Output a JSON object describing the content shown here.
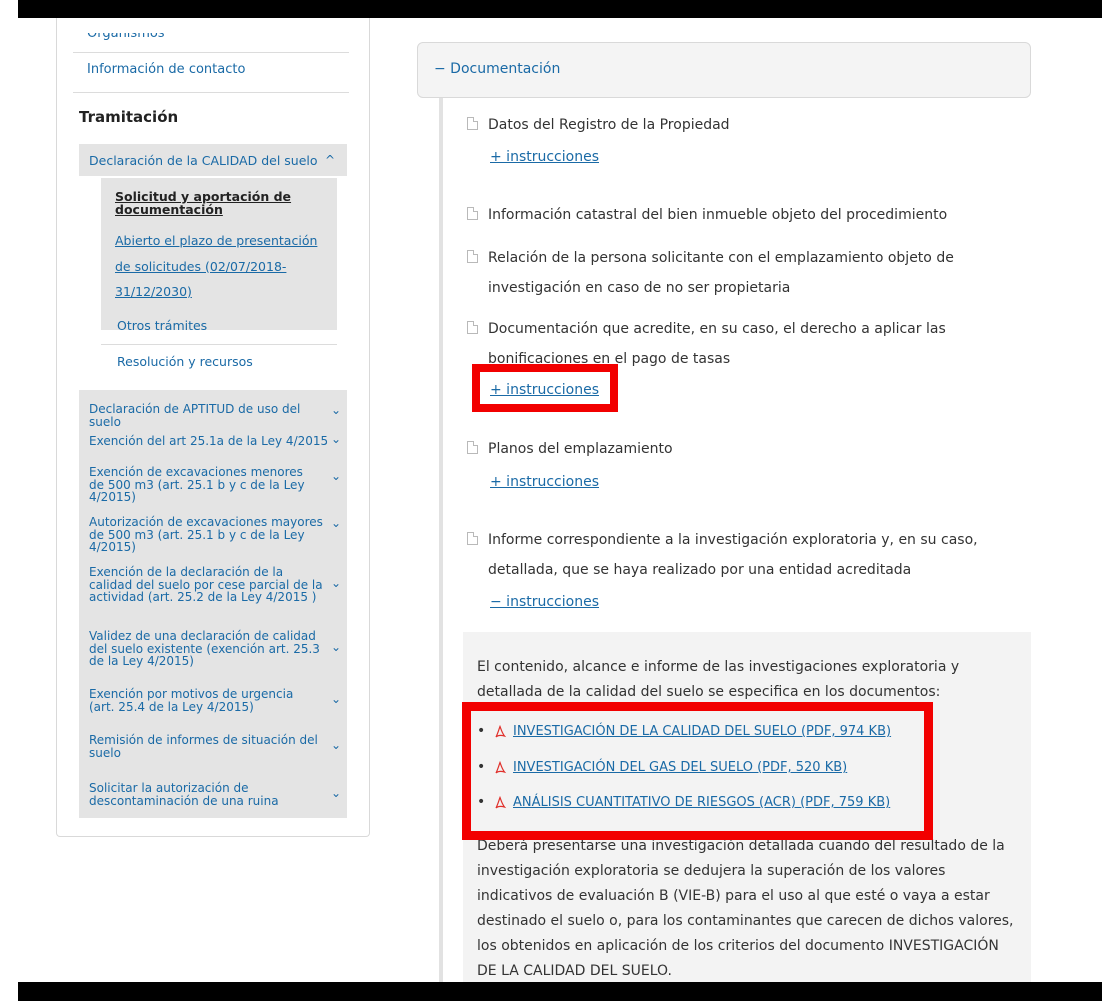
{
  "sidebar": {
    "organismos": "Organismos",
    "contacto": "Información de contacto",
    "tramitacion_heading": "Tramitación",
    "open_section": {
      "label": "Declaración de la CALIDAD del suelo",
      "caret": "^",
      "active_item": "Solicitud y aportación de documentación",
      "open_period": "Abierto el plazo de presentación de solicitudes (02/07/2018-31/12/2030)",
      "otros": "Otros trámites",
      "resolucion": "Resolución y recursos"
    },
    "sections": [
      {
        "label": "Declaración de APTITUD de uso del suelo"
      },
      {
        "label": "Exención del art 25.1a de la Ley 4/2015"
      },
      {
        "label": "Exención de excavaciones menores de 500 m3 (art. 25.1 b y c de la Ley 4/2015)"
      },
      {
        "label": "Autorización de excavaciones mayores de 500 m3 (art. 25.1 b y c de la Ley 4/2015)"
      },
      {
        "label": "Exención de la declaración de la calidad del suelo por cese parcial de la actividad (art. 25.2 de la Ley 4/2015 )"
      },
      {
        "label": "Validez de una declaración de calidad del suelo existente (exención art. 25.3 de la Ley 4/2015)"
      },
      {
        "label": "Exención por motivos de urgencia (art. 25.4 de la Ley 4/2015)"
      },
      {
        "label": "Remisión de informes de situación del suelo"
      },
      {
        "label": "Solicitar la autorización de descontaminación de una ruina"
      }
    ]
  },
  "main": {
    "header": "− Documentación",
    "items": [
      {
        "text": "Datos del Registro de la Propiedad",
        "instr": "+ instrucciones"
      },
      {
        "text": "Información catastral del bien inmueble objeto del procedimiento"
      },
      {
        "text": "Relación de la persona solicitante con el emplazamiento objeto de investigación en caso de no ser propietaria"
      },
      {
        "text": "Documentación que acredite, en su caso, el derecho a aplicar las bonificaciones en el pago de tasas",
        "instr": "+ instrucciones"
      },
      {
        "text": "Planos del emplazamiento",
        "instr": "+ instrucciones"
      },
      {
        "text": "Informe correspondiente a la investigación exploratoria y, en su caso, detallada, que se haya realizado por una entidad acreditada",
        "instr": "− instrucciones"
      }
    ],
    "info_intro": "El contenido, alcance e informe de las investigaciones exploratoria y detallada de la calidad del suelo se especifica en los documentos:",
    "bullet": "•",
    "pdf_links": [
      "INVESTIGACIÓN DE LA CALIDAD DEL SUELO (PDF, 974 KB)",
      "INVESTIGACIÓN DEL GAS DEL SUELO (PDF, 520 KB)",
      "ANÁLISIS CUANTITATIVO DE RIESGOS (ACR) (PDF, 759 KB)"
    ],
    "info_outro": "Deberá presentarse una investigación detallada cuando del resultado de la investigación exploratoria se dedujera la superación de los valores indicativos de evaluación B (VIE-B) para el uso al que esté o vaya a estar destinado el suelo o, para los contaminantes que carecen de dichos valores, los obtenidos en aplicación de los criterios del documento INVESTIGACIÓN DE LA CALIDAD DEL SUELO."
  },
  "colors": {
    "link": "#1a6aa6",
    "highlight": "#f20000",
    "frame": "#000000"
  }
}
